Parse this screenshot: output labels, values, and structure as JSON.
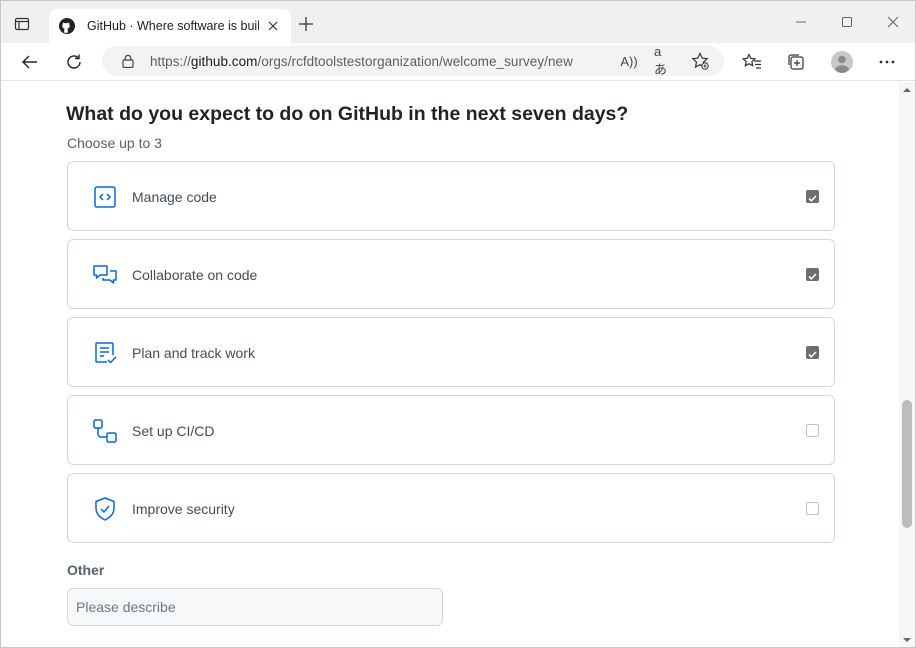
{
  "browser": {
    "tab_title": "GitHub · Where software is built",
    "url_prefix": "https://",
    "url_host": "github.com",
    "url_path": "/orgs/rcfdtoolstestorganization/welcome_survey/new",
    "read_aloud_glyph": "A))",
    "translate_glyph": "aあ"
  },
  "survey": {
    "question": "What do you expect to do on GitHub in the next seven days?",
    "hint": "Choose up to 3",
    "options": [
      {
        "label": "Manage code",
        "checked": true,
        "icon": "code-icon"
      },
      {
        "label": "Collaborate on code",
        "checked": true,
        "icon": "comment-discussion-icon"
      },
      {
        "label": "Plan and track work",
        "checked": true,
        "icon": "issue-tracks-icon"
      },
      {
        "label": "Set up CI/CD",
        "checked": false,
        "icon": "workflow-icon"
      },
      {
        "label": "Improve security",
        "checked": false,
        "icon": "shield-check-icon"
      }
    ],
    "other_label": "Other",
    "other_placeholder": "Please describe",
    "other_value": ""
  },
  "colors": {
    "accent_icon": "#0969da",
    "checkbox_checked": "#6e6e6e"
  }
}
